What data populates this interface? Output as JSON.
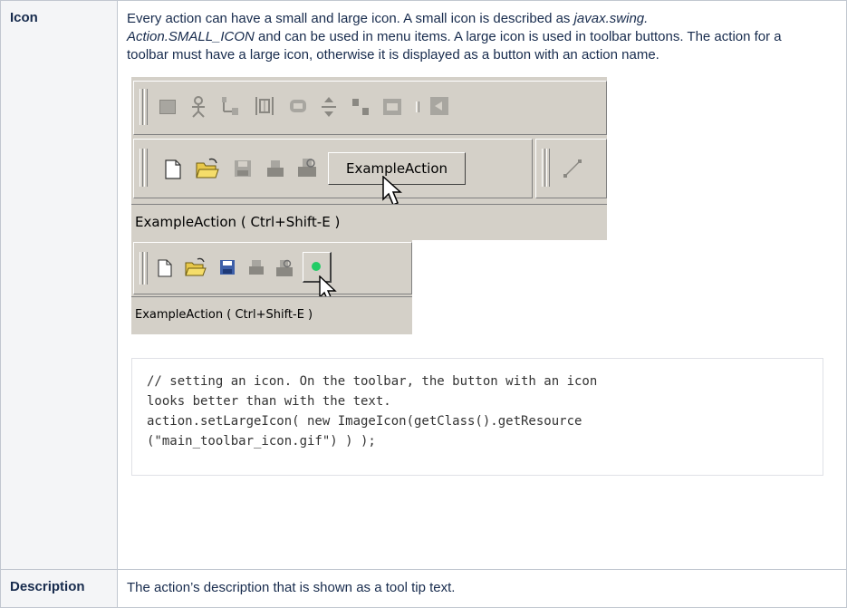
{
  "rows": [
    {
      "label": "Icon",
      "paragraph": {
        "part1": "Every action can have a small and large icon. A small icon is described as ",
        "italic1": "javax.swing.",
        "italic2": "Action.SMALL_ICON",
        "part2": " and can be used in menu items. A large icon is used in toolbar buttons. The action for a toolbar must have a large icon, otherwise it is displayed as a button with an action name."
      },
      "screenshot1": {
        "button_label": "ExampleAction",
        "status_text": "ExampleAction ( Ctrl+Shift-E )"
      },
      "screenshot2": {
        "status_text": "ExampleAction ( Ctrl+Shift-E )",
        "icon_color": "#22cc66"
      },
      "code_lines": [
        "// setting an icon. On the toolbar, the button with an icon",
        "looks better than with the text.",
        "action.setLargeIcon( new ImageIcon(getClass().getResource",
        "(\"main_toolbar_icon.gif\") ) );"
      ]
    },
    {
      "label": "Description",
      "text": "The action’s description that is shown as a tool tip text."
    }
  ]
}
